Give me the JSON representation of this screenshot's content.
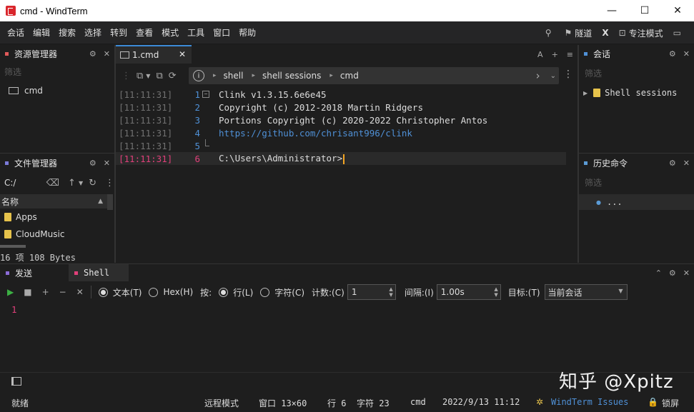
{
  "window": {
    "title": "cmd - WindTerm",
    "minimize": "—",
    "maximize": "☐",
    "close": "✕"
  },
  "menubar": {
    "items": [
      "会话",
      "编辑",
      "搜索",
      "选择",
      "转到",
      "查看",
      "模式",
      "工具",
      "窗口",
      "帮助"
    ],
    "tunnel": "隧道",
    "x_label": "X",
    "focus_mode": "专注模式"
  },
  "explorer": {
    "title": "资源管理器",
    "filter_placeholder": "筛选",
    "items": [
      {
        "label": "cmd"
      }
    ]
  },
  "file_manager": {
    "title": "文件管理器",
    "path": "C:/",
    "column_name": "名称",
    "items": [
      {
        "label": "Apps"
      },
      {
        "label": "CloudMusic"
      }
    ],
    "status": "16 项 108 Bytes"
  },
  "editor": {
    "tab_label": "1.cmd",
    "tab_close": "✕",
    "tools": [
      "A",
      "+",
      "≡"
    ],
    "breadcrumb": [
      "shell",
      "shell sessions",
      "cmd"
    ],
    "breadcrumb_sep": "▸",
    "info": "i"
  },
  "terminal": {
    "lines": [
      {
        "ts": "[11:11:31]",
        "num": "1",
        "text": "Clink v1.3.15.6e6e45"
      },
      {
        "ts": "[11:11:31]",
        "num": "2",
        "text": "Copyright (c) 2012-2018 Martin Ridgers"
      },
      {
        "ts": "[11:11:31]",
        "num": "3",
        "text": "Portions Copyright (c) 2020-2022 Christopher Antos"
      },
      {
        "ts": "[11:11:31]",
        "num": "4",
        "text": "https://github.com/chrisant996/clink"
      },
      {
        "ts": "[11:11:31]",
        "num": "5",
        "text": ""
      },
      {
        "ts": "[11:11:31]",
        "num": "6",
        "text": "C:\\Users\\Administrator>"
      }
    ],
    "fold_marker": "−"
  },
  "sessions": {
    "title": "会话",
    "filter_placeholder": "筛选",
    "items": [
      {
        "label": "Shell sessions"
      }
    ]
  },
  "history": {
    "title": "历史命令",
    "filter_placeholder": "筛选",
    "items": [
      {
        "label": "..."
      }
    ]
  },
  "bottom": {
    "send_tab": "发送",
    "shell_tab": "Shell",
    "text_opt": "文本(T)",
    "hex_opt": "Hex(H)",
    "by_label": "按:",
    "line_opt": "行(L)",
    "char_opt": "字符(C)",
    "count_label": "计数:(C)",
    "count_value": "1",
    "interval_label": "间隔:(I)",
    "interval_value": "1.00s",
    "target_label": "目标:(T)",
    "target_value": "当前会话",
    "send_line_number": "1"
  },
  "statusbar": {
    "ready": "就绪",
    "mode": "远程模式",
    "window": "窗口 13×60",
    "line": "行 6",
    "char": "字符 23",
    "shell": "cmd",
    "datetime": "2022/9/13 11:12",
    "issues": "WindTerm Issues",
    "lock": "锁屏"
  },
  "watermark": "知乎 @Xpitz",
  "colors": {
    "accent_blue": "#4f90d6",
    "current_line_pink": "#e0407a",
    "explorer_marker": "#e05a5a",
    "filemgr_marker": "#7a7ad8",
    "history_marker": "#5b9bd5",
    "send_marker": "#8b6cd8",
    "shell_marker": "#e0407a",
    "link_blue": "#4f90d6"
  }
}
